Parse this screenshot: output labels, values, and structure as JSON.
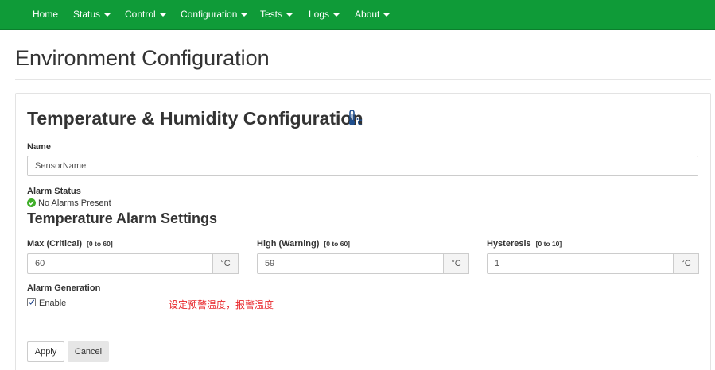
{
  "nav": {
    "items": [
      {
        "label": "Home",
        "dropdown": false
      },
      {
        "label": "Status",
        "dropdown": true
      },
      {
        "label": "Control",
        "dropdown": true
      },
      {
        "label": "Configuration",
        "dropdown": true
      },
      {
        "label": "Tests",
        "dropdown": true
      },
      {
        "label": "Logs",
        "dropdown": true
      },
      {
        "label": "About",
        "dropdown": true
      }
    ],
    "color": "#0f9b38"
  },
  "page": {
    "title": "Environment Configuration"
  },
  "section": {
    "title": "Temperature & Humidity Configuration",
    "icon": "thermometer-celsius-icon"
  },
  "name_field": {
    "label": "Name",
    "value": "SensorName"
  },
  "alarm_status": {
    "label": "Alarm Status",
    "text": "No Alarms Present",
    "icon": "check-circle-icon",
    "color": "#3fae29"
  },
  "temp_settings": {
    "title": "Temperature Alarm Settings",
    "fields": [
      {
        "label": "Max (Critical)",
        "range": "[0 to 60]",
        "value": "60",
        "unit": "°C"
      },
      {
        "label": "High (Warning)",
        "range": "[0 to 60]",
        "value": "59",
        "unit": "°C"
      },
      {
        "label": "Hysteresis",
        "range": "[0 to 10]",
        "value": "1",
        "unit": "°C"
      }
    ]
  },
  "alarm_generation": {
    "label": "Alarm Generation",
    "checkbox_label": "Enable",
    "checked": true
  },
  "annotation": {
    "text": "设定预警温度，报警温度",
    "color": "#e8262a"
  },
  "buttons": {
    "apply": "Apply",
    "cancel": "Cancel"
  }
}
